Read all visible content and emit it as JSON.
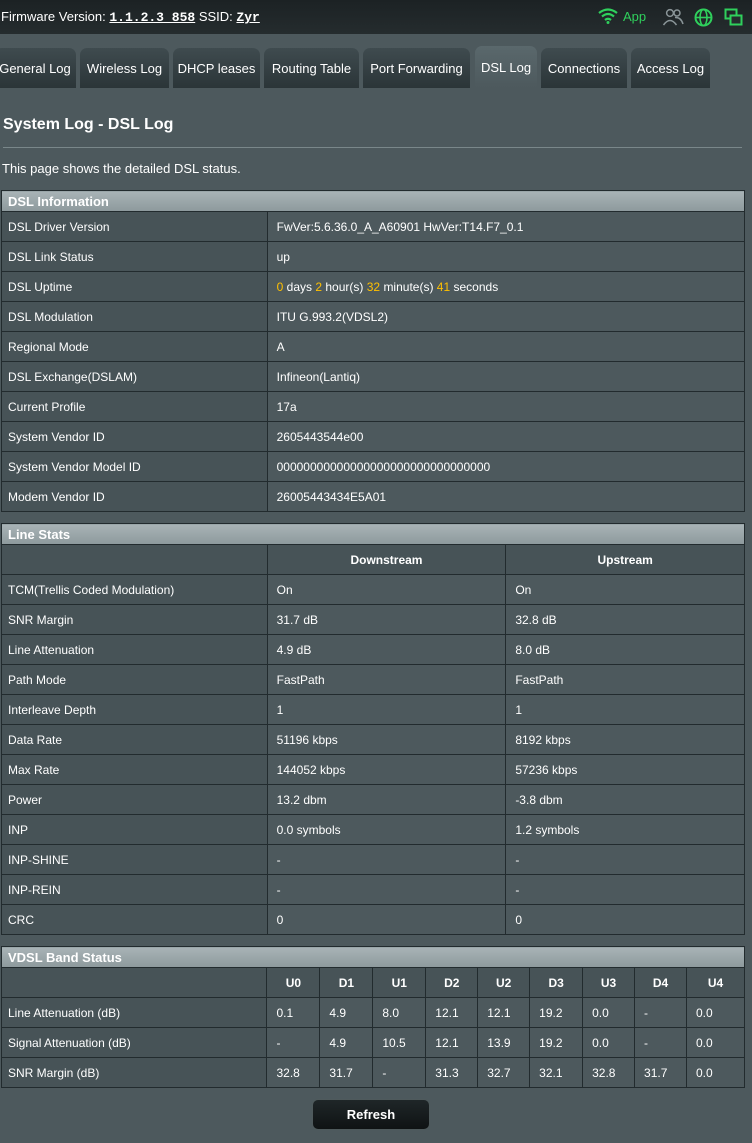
{
  "header": {
    "firmware_label": "Firmware Version:",
    "firmware_value": "1.1.2.3_858",
    "ssid_label": "SSID:",
    "ssid_value": "Zyr",
    "app_label": "App",
    "app_color": "#2fd05c"
  },
  "tabs": [
    {
      "label": "General Log"
    },
    {
      "label": "Wireless Log"
    },
    {
      "label": "DHCP leases"
    },
    {
      "label": "Routing Table"
    },
    {
      "label": "Port Forwarding"
    },
    {
      "label": "DSL Log",
      "active": true
    },
    {
      "label": "Connections"
    },
    {
      "label": "Access Log"
    }
  ],
  "page": {
    "title": "System Log - DSL Log",
    "description": "This page shows the detailed DSL status."
  },
  "dsl_info": {
    "heading": "DSL Information",
    "rows": [
      {
        "label": "DSL Driver Version",
        "value": "FwVer:5.6.36.0_A_A60901 HwVer:T14.F7_0.1"
      },
      {
        "label": "DSL Link Status",
        "value": "up"
      },
      {
        "label": "DSL Uptime",
        "value": ""
      },
      {
        "label": "DSL Modulation",
        "value": "ITU G.993.2(VDSL2)"
      },
      {
        "label": "Regional Mode",
        "value": "A"
      },
      {
        "label": "DSL Exchange(DSLAM)",
        "value": "Infineon(Lantiq)"
      },
      {
        "label": "Current Profile",
        "value": "17a"
      },
      {
        "label": "System Vendor ID",
        "value": "2605443544e00"
      },
      {
        "label": "System Vendor Model ID",
        "value": "00000000000000000000000000000000"
      },
      {
        "label": "Modem Vendor ID",
        "value": "26005443434E5A01"
      }
    ],
    "uptime": {
      "days": "0",
      "days_unit": "days",
      "hours": "2",
      "hours_unit": "hour(s)",
      "minutes": "32",
      "minutes_unit": "minute(s)",
      "seconds": "41",
      "seconds_unit": "seconds"
    }
  },
  "line_stats": {
    "heading": "Line Stats",
    "col_down": "Downstream",
    "col_up": "Upstream",
    "rows": [
      {
        "label": "TCM(Trellis Coded Modulation)",
        "down": "On",
        "up": "On"
      },
      {
        "label": "SNR Margin",
        "down": "31.7 dB",
        "up": "32.8 dB"
      },
      {
        "label": "Line Attenuation",
        "down": "4.9 dB",
        "up": "8.0 dB"
      },
      {
        "label": "Path Mode",
        "down": "FastPath",
        "up": "FastPath"
      },
      {
        "label": "Interleave Depth",
        "down": "1",
        "up": "1"
      },
      {
        "label": "Data Rate",
        "down": "51196 kbps",
        "up": "8192 kbps"
      },
      {
        "label": "Max Rate",
        "down": "144052 kbps",
        "up": "57236 kbps"
      },
      {
        "label": "Power",
        "down": "13.2 dbm",
        "up": "-3.8 dbm"
      },
      {
        "label": "INP",
        "down": "0.0 symbols",
        "up": "1.2 symbols"
      },
      {
        "label": "INP-SHINE",
        "down": "-",
        "up": "-"
      },
      {
        "label": "INP-REIN",
        "down": "-",
        "up": "-"
      },
      {
        "label": "CRC",
        "down": "0",
        "up": "0"
      }
    ]
  },
  "vdsl_band": {
    "heading": "VDSL Band Status",
    "columns": [
      "U0",
      "D1",
      "U1",
      "D2",
      "U2",
      "D3",
      "U3",
      "D4",
      "U4"
    ],
    "rows": [
      {
        "label": "Line Attenuation (dB)",
        "values": [
          "0.1",
          "4.9",
          "8.0",
          "12.1",
          "12.1",
          "19.2",
          "0.0",
          "-",
          "0.0"
        ]
      },
      {
        "label": "Signal Attenuation (dB)",
        "values": [
          "-",
          "4.9",
          "10.5",
          "12.1",
          "13.9",
          "19.2",
          "0.0",
          "-",
          "0.0"
        ]
      },
      {
        "label": "SNR Margin (dB)",
        "values": [
          "32.8",
          "31.7",
          "-",
          "31.3",
          "32.7",
          "32.1",
          "32.8",
          "31.7",
          "0.0"
        ]
      }
    ]
  },
  "refresh_label": "Refresh",
  "colors": {
    "upstream_value": "#3ab4e6",
    "downstream_value": "#ff9a3c",
    "uptime_number": "#ffc000",
    "background": "#4d595d"
  }
}
